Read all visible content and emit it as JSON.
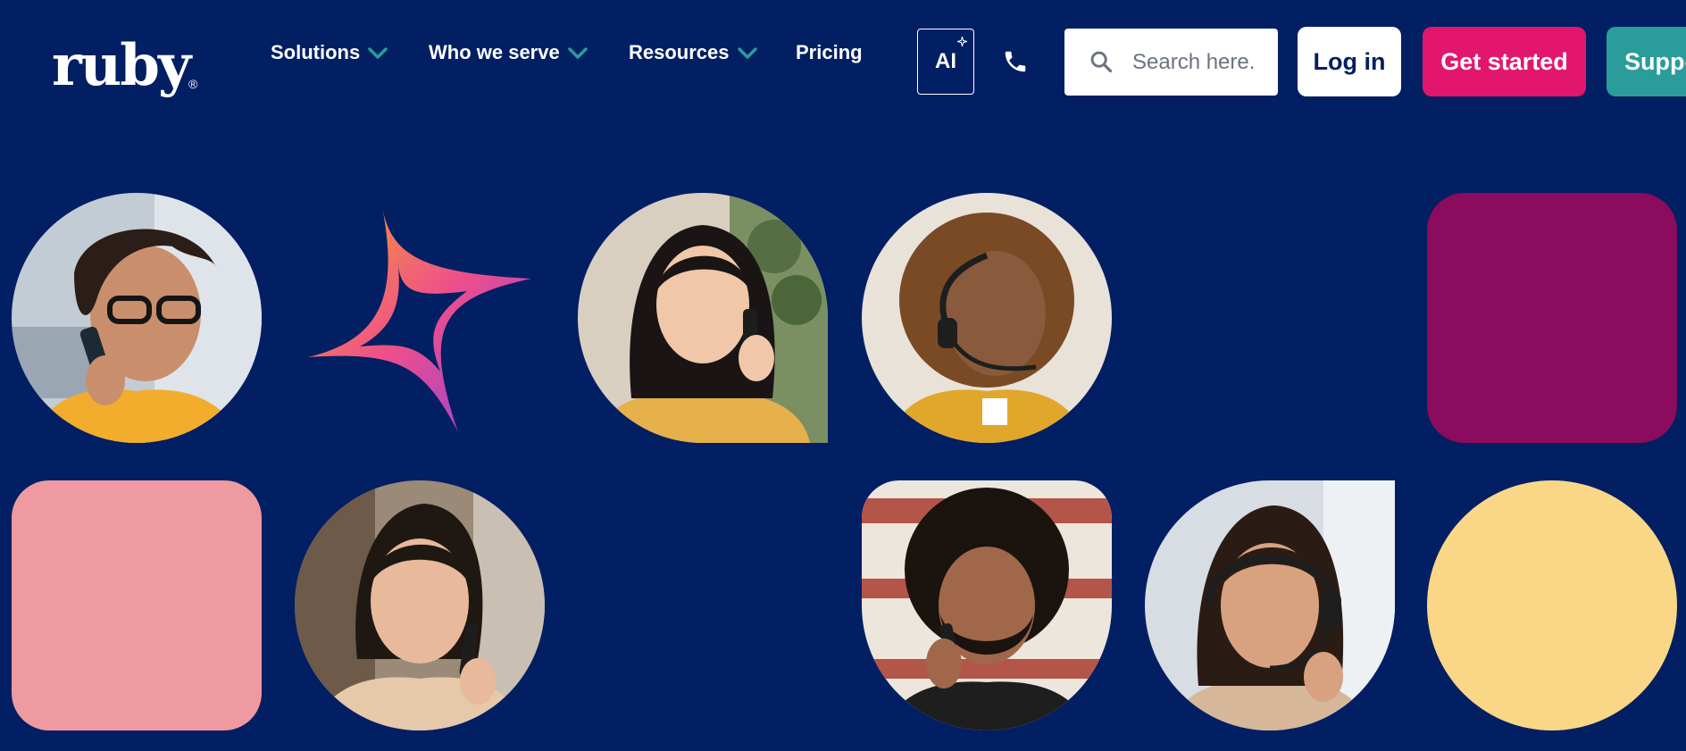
{
  "brand": {
    "name": "ruby",
    "registered": "®"
  },
  "nav": {
    "items": [
      {
        "label": "Solutions",
        "has_dropdown": true
      },
      {
        "label": "Who we serve",
        "has_dropdown": true
      },
      {
        "label": "Resources",
        "has_dropdown": true
      },
      {
        "label": "Pricing",
        "has_dropdown": false
      }
    ]
  },
  "actions": {
    "ai_label": "AI",
    "search_placeholder": "Search here.",
    "login_label": "Log in",
    "get_started_label": "Get started",
    "support_label": "Support"
  },
  "colors": {
    "background": "#021f63",
    "chevron": "#2a9c99",
    "get_started": "#e3166e",
    "support": "#2a9c99",
    "tile_plum": "#8b0b5e",
    "tile_pink": "#ef9aa0",
    "tile_yellow": "#f9d787"
  },
  "icons": [
    "chevron-down-icon",
    "sparkle-icon",
    "phone-icon",
    "search-icon",
    "star-logo-icon"
  ],
  "hero_tiles": [
    {
      "kind": "photo",
      "subject": "woman on phone with glasses"
    },
    {
      "kind": "star-shape"
    },
    {
      "kind": "photo",
      "subject": "woman on phone"
    },
    {
      "kind": "photo",
      "subject": "woman with headset"
    },
    {
      "kind": "color-block",
      "color": "#8b0b5e"
    },
    {
      "kind": "color-block",
      "color": "#ef9aa0"
    },
    {
      "kind": "photo",
      "subject": "woman smiling on phone"
    },
    {
      "kind": "photo",
      "subject": "man laughing on phone"
    },
    {
      "kind": "photo",
      "subject": "woman with headset smiling"
    },
    {
      "kind": "color-circle",
      "color": "#f9d787"
    }
  ]
}
